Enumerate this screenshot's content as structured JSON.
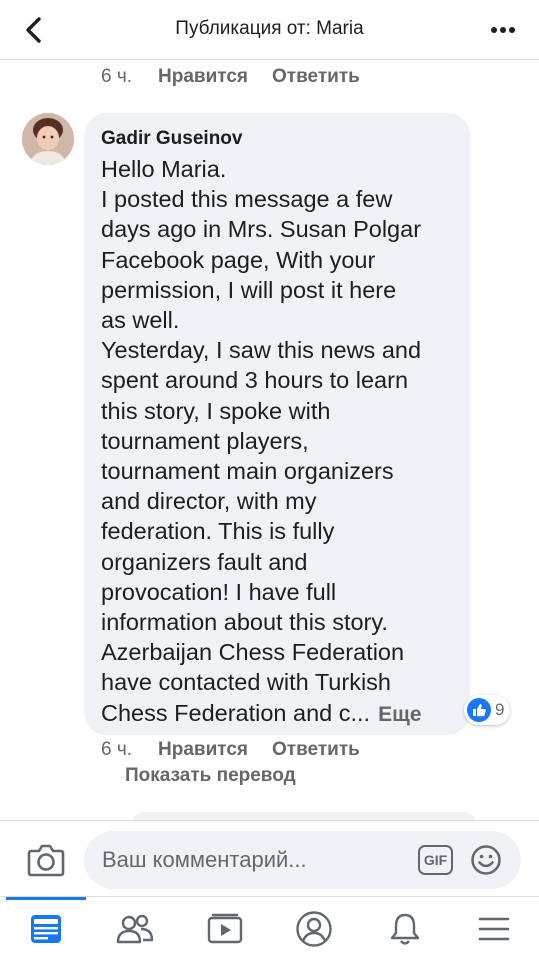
{
  "header": {
    "title": "Публикация от: Maria",
    "back_icon": "chevron-left-icon",
    "more_icon": "more-horizontal-icon"
  },
  "previous_comment": {
    "time": "6 ч.",
    "like_label": "Нравится",
    "reply_label": "Ответить"
  },
  "comment": {
    "author": "Gadir Guseinov",
    "lines": [
      "Hello Maria.",
      "I posted this message a few",
      "days ago in Mrs. Susan Polgar",
      "Facebook page, With your",
      "permission, I will post it here",
      "as well.",
      "Yesterday, I saw this news and",
      "spent around 3 hours to learn",
      "this story, I spoke with",
      "tournament players,",
      "tournament main organizers",
      "and director, with my",
      "federation. This is fully",
      "organizers fault and",
      "provocation! I have full",
      "information about this story.",
      "Azerbaijan Chess Federation",
      "have contacted with Turkish"
    ],
    "last_line": "Chess Federation and c...",
    "more_label": "Еще",
    "reaction_count": "9",
    "time": "6 ч.",
    "like_label": "Нравится",
    "reply_label": "Ответить",
    "translate_label": "Показать перевод"
  },
  "composer": {
    "placeholder": "Ваш комментарий...",
    "gif_label": "GIF"
  },
  "bottom_nav": {
    "tabs": [
      "news-feed-icon",
      "friends-icon",
      "watch-icon",
      "profile-icon",
      "notifications-icon",
      "menu-icon"
    ],
    "active": "news-feed-icon"
  },
  "colors": {
    "accent": "#1877f2",
    "bubble": "#f0f2f5",
    "secondary_text": "#65676b"
  }
}
